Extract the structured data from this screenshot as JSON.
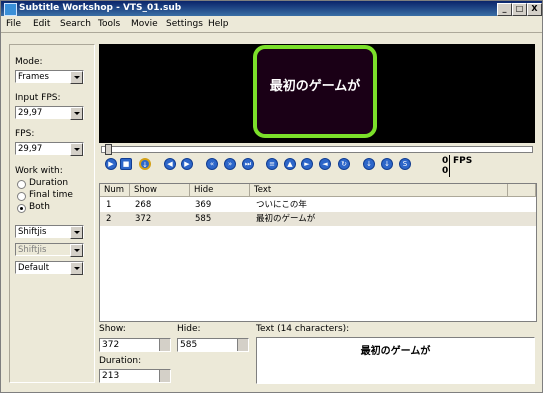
{
  "window": {
    "title": "Subtitle Workshop - VTS_01.sub",
    "controls": [
      "_",
      "□",
      "X"
    ]
  },
  "menu": [
    "File",
    "Edit",
    "Search",
    "Tools",
    "Movie",
    "Settings",
    "Help"
  ],
  "left": {
    "mode_label": "Mode:",
    "mode_value": "Frames",
    "input_fps_label": "Input FPS:",
    "input_fps_value": "29,97",
    "fps_label": "FPS:",
    "fps_value": "29,97",
    "work_with_label": "Work with:",
    "radios": [
      {
        "label": "Duration",
        "checked": false
      },
      {
        "label": "Final time",
        "checked": false
      },
      {
        "label": "Both",
        "checked": true
      }
    ],
    "combo1": "Shiftjis",
    "combo2": "Shiftjis",
    "combo3": "Default"
  },
  "video": {
    "subtitle": "最初のゲームが"
  },
  "playback": {
    "fps_top": "0",
    "fps_bottom": "0",
    "fps_label": "FPS"
  },
  "grid": {
    "columns": [
      "Num",
      "Show",
      "Hide",
      "Text"
    ],
    "rows": [
      {
        "num": "1",
        "show": "268",
        "hide": "369",
        "text": "ついにこの年"
      },
      {
        "num": "2",
        "show": "372",
        "hide": "585",
        "text": "最初のゲームが"
      }
    ]
  },
  "editor": {
    "show_label": "Show:",
    "show_value": "372",
    "hide_label": "Hide:",
    "hide_value": "585",
    "duration_label": "Duration:",
    "duration_value": "213",
    "text_label": "Text (14 characters):",
    "text_value": "最初のゲームが"
  },
  "colors": {
    "title_bar": "#0a246a",
    "video_frame_border": "#7be02a",
    "button_blue": "#2d66c9"
  }
}
